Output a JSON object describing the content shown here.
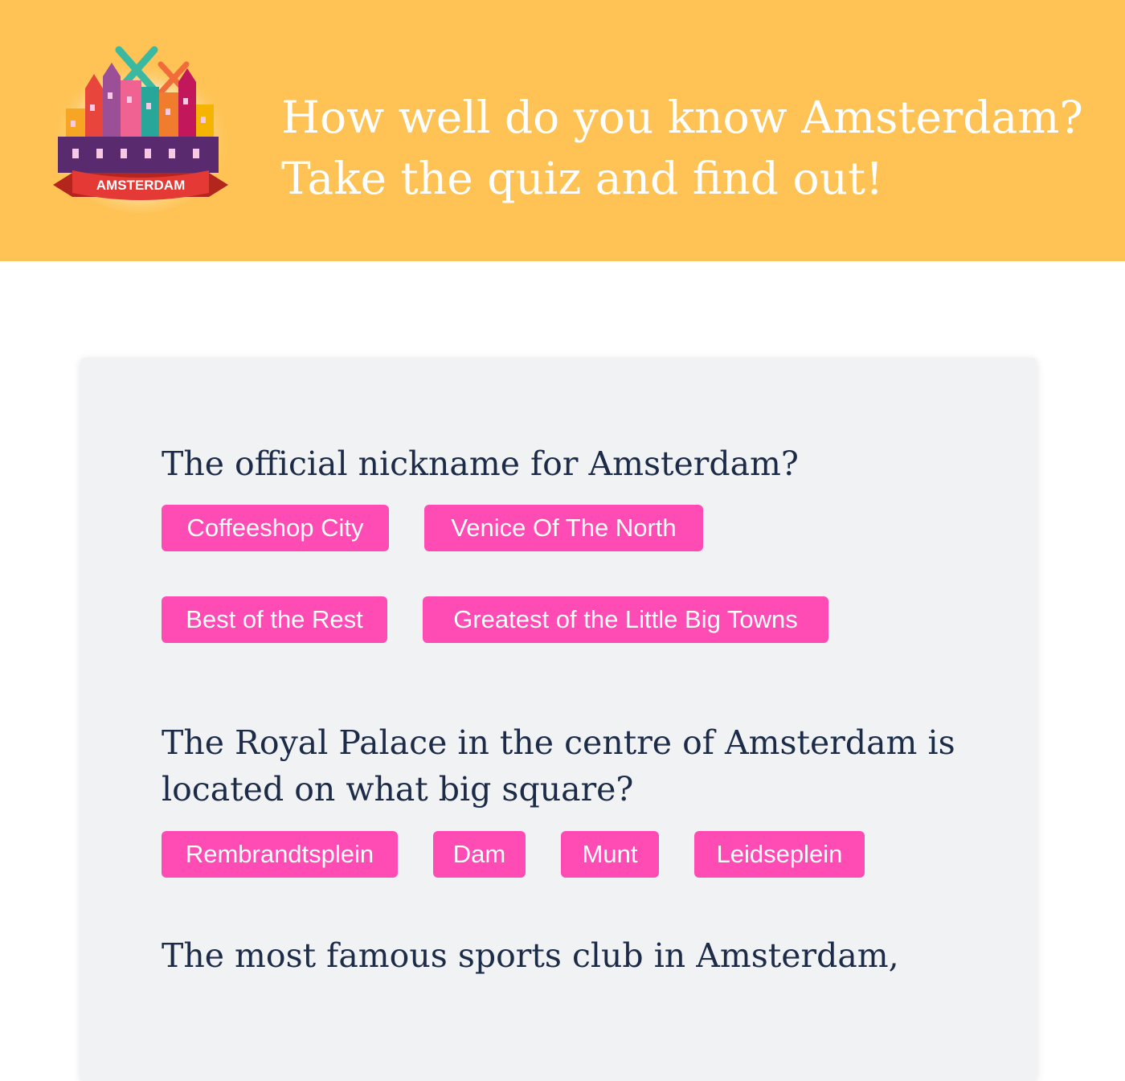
{
  "header": {
    "logo_text": "AMSTERDAM",
    "title_line1": "How well do you know Amsterdam?",
    "title_line2": "Take the quiz and find out!"
  },
  "questions": [
    {
      "text": "The official nickname for Amsterdam?",
      "answers": [
        "Coffeeshop City",
        "Venice Of The North",
        "Best of the Rest",
        "Greatest of the Little Big Towns"
      ]
    },
    {
      "text": "The Royal Palace in the centre of Amsterdam is located on what big square?",
      "answers": [
        "Rembrandtsplein",
        "Dam",
        "Munt",
        "Leidseplein"
      ]
    },
    {
      "text": "The most famous sports club in Amsterdam,"
    }
  ],
  "colors": {
    "header_bg": "#fec354",
    "answer_bg": "#ff4bb4",
    "question_text": "#1c2b47",
    "card_bg": "#f1f2f4"
  }
}
